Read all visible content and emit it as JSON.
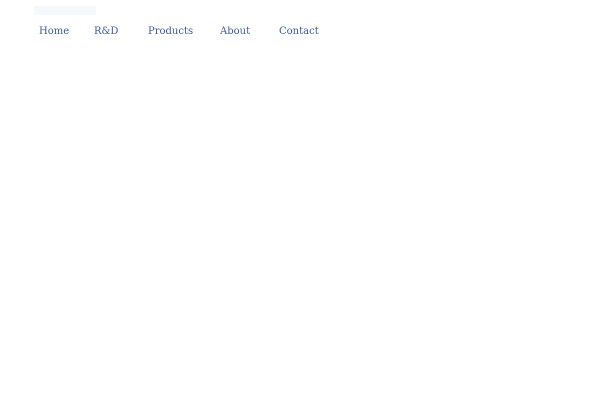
{
  "nav": {
    "items": [
      {
        "label": "Home"
      },
      {
        "label": "R&D"
      },
      {
        "label": "Products"
      },
      {
        "label": "About"
      },
      {
        "label": "Contact"
      }
    ],
    "link_color": "#3c5aa8"
  },
  "page": {
    "background": "#ffffff"
  }
}
